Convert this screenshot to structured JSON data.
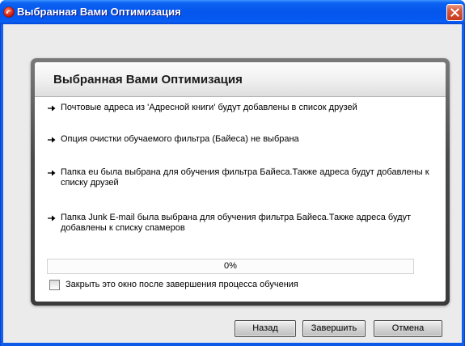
{
  "window": {
    "title": "Выбранная Вами Оптимизация"
  },
  "icons": {
    "app": "app-logo-icon",
    "close": "close-icon",
    "bullet": "arrow-right-icon"
  },
  "panel": {
    "heading": "Выбранная Вами Оптимизация",
    "items": [
      {
        "lines": [
          "Почтовые адреса из 'Адресной книги' будут добавлены в список друзей"
        ]
      },
      {
        "lines": [
          "Опция очистки обучаемого фильтра (Байеса) не выбрана"
        ]
      },
      {
        "lines": [
          "Папка eu была выбрана для обучения фильтра Байеса.Также адреса будут добавлены к",
          "списку друзей"
        ]
      },
      {
        "lines": [
          "Папка Junk E-mail была выбрана для обучения фильтра Байеса.Также адреса будут",
          "добавлены к списку спамеров"
        ]
      }
    ]
  },
  "progress": {
    "label": "0%",
    "value": 0
  },
  "close_on_finish": {
    "label": "Закрыть это окно после завершения процесса обучения",
    "checked": false
  },
  "buttons": {
    "back": "Назад",
    "finish": "Завершить",
    "cancel": "Отмена"
  },
  "colors": {
    "client_background": "#EBEBEB",
    "title_bar": "#0556EC",
    "close_button": "#D9583C",
    "panel_frame": "#4A4A4A"
  }
}
